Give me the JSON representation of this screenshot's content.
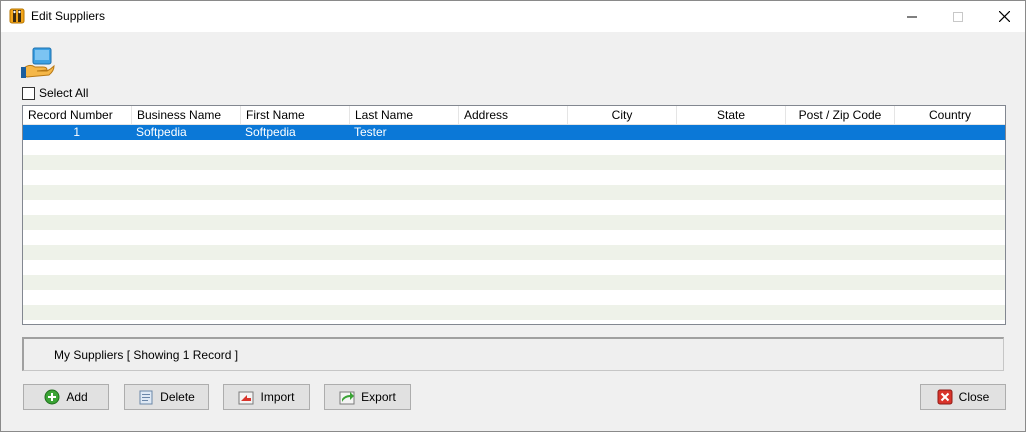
{
  "window": {
    "title": "Edit Suppliers"
  },
  "select_all": {
    "label": "Select All",
    "checked": false
  },
  "grid": {
    "columns": [
      "Record Number",
      "Business Name",
      "First Name",
      "Last Name",
      "Address",
      "City",
      "State",
      "Post / Zip Code",
      "Country"
    ],
    "rows": [
      {
        "record_number": "1",
        "business_name": "Softpedia",
        "first_name": "Softpedia",
        "last_name": "Tester",
        "address": "",
        "city": "",
        "state": "",
        "post_zip_code": "",
        "country": "",
        "selected": true
      }
    ],
    "selection_color": "#0b78d7",
    "alt_row_color": "#eef2e9"
  },
  "status": {
    "text": "My Suppliers [ Showing 1 Record ]"
  },
  "buttons": {
    "add": "Add",
    "delete": "Delete",
    "import": "Import",
    "export": "Export",
    "close": "Close"
  },
  "icons": {
    "app": "info-icon",
    "header": "supplier-hand-icon",
    "add": "plus-circle-icon",
    "delete": "delete-icon",
    "import": "import-icon",
    "export": "export-icon",
    "close": "close-x-icon"
  }
}
